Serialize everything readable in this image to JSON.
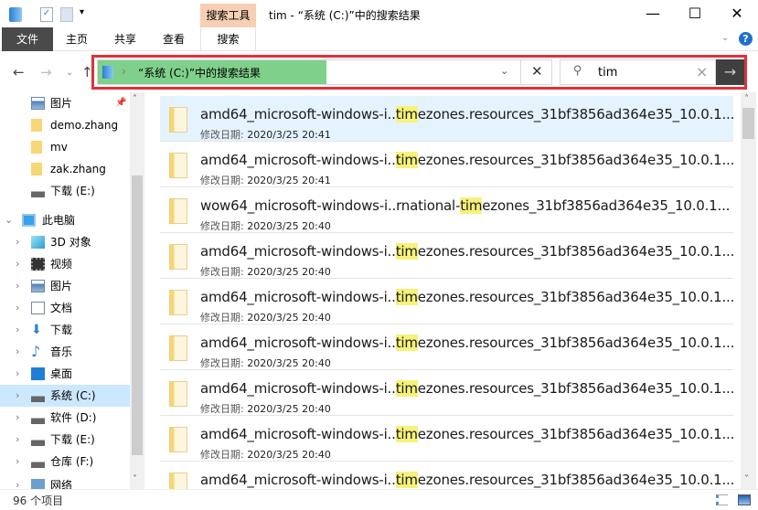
{
  "window": {
    "title": "tim - “系统 (C:)”中的搜索结果",
    "context_tab": "搜索工具",
    "minimize": "—",
    "maximize": "☐",
    "close": "✕"
  },
  "ribbon": {
    "tabs": [
      "文件",
      "主页",
      "共享",
      "查看",
      "搜索"
    ]
  },
  "address": {
    "path": "“系统 (C:)”中的搜索结果",
    "separator": "›"
  },
  "search": {
    "value": "tim",
    "clear": "×",
    "go": "→"
  },
  "nav": {
    "items": [
      {
        "label": "图片",
        "icon": "pictures-icon",
        "pinned": true
      },
      {
        "label": "demo.zhang",
        "icon": "folder-icon"
      },
      {
        "label": "mv",
        "icon": "folder-icon"
      },
      {
        "label": "zak.zhang",
        "icon": "folder-icon"
      },
      {
        "label": "下载 (E:)",
        "icon": "drive-icon"
      },
      {
        "label": "此电脑",
        "icon": "computer-icon",
        "expanded": true
      },
      {
        "label": "3D 对象",
        "icon": "3d-objects-icon"
      },
      {
        "label": "视频",
        "icon": "videos-icon"
      },
      {
        "label": "图片",
        "icon": "pictures-icon"
      },
      {
        "label": "文档",
        "icon": "documents-icon"
      },
      {
        "label": "下载",
        "icon": "downloads-icon"
      },
      {
        "label": "音乐",
        "icon": "music-icon"
      },
      {
        "label": "桌面",
        "icon": "desktop-icon"
      },
      {
        "label": "系统 (C:)",
        "icon": "system-drive-icon",
        "selected": true
      },
      {
        "label": "软件 (D:)",
        "icon": "drive-icon"
      },
      {
        "label": "下载 (E:)",
        "icon": "drive-icon"
      },
      {
        "label": "仓库 (F:)",
        "icon": "drive-icon"
      },
      {
        "label": "网络",
        "icon": "network-icon"
      }
    ]
  },
  "results": {
    "date_label": "修改日期:",
    "items": [
      {
        "pre": "amd64_microsoft-windows-i..",
        "hit": "tim",
        "post": "ezones.resources_31bf3856ad364e35_10.0.1...",
        "date": "2020/3/25 20:41",
        "selected": true
      },
      {
        "pre": "amd64_microsoft-windows-i..",
        "hit": "tim",
        "post": "ezones.resources_31bf3856ad364e35_10.0.1...",
        "date": "2020/3/25 20:41"
      },
      {
        "pre": "wow64_microsoft-windows-i..rnational-",
        "hit": "tim",
        "post": "ezones_31bf3856ad364e35_10.0.1...",
        "date": "2020/3/25 20:40"
      },
      {
        "pre": "amd64_microsoft-windows-i..",
        "hit": "tim",
        "post": "ezones.resources_31bf3856ad364e35_10.0.1...",
        "date": "2020/3/25 20:40"
      },
      {
        "pre": "amd64_microsoft-windows-i..",
        "hit": "tim",
        "post": "ezones.resources_31bf3856ad364e35_10.0.1...",
        "date": "2020/3/25 20:40"
      },
      {
        "pre": "amd64_microsoft-windows-i..",
        "hit": "tim",
        "post": "ezones.resources_31bf3856ad364e35_10.0.1...",
        "date": "2020/3/25 20:40"
      },
      {
        "pre": "amd64_microsoft-windows-i..",
        "hit": "tim",
        "post": "ezones.resources_31bf3856ad364e35_10.0.1...",
        "date": "2020/3/25 20:40"
      },
      {
        "pre": "amd64_microsoft-windows-i..",
        "hit": "tim",
        "post": "ezones.resources_31bf3856ad364e35_10.0.1...",
        "date": "2020/3/25 20:40"
      },
      {
        "pre": "amd64_microsoft-windows-i..",
        "hit": "tim",
        "post": "ezones.resources_31bf3856ad364e35_10.0.1...",
        "date": ""
      }
    ]
  },
  "status": {
    "count": "96 个项目"
  },
  "colors": {
    "highlight_box": "#e0313b",
    "address_fill": "#7fd08a",
    "match_highlight": "#f6f27a",
    "selection": "#cce8ff",
    "context_tab": "#f8cfb4"
  }
}
